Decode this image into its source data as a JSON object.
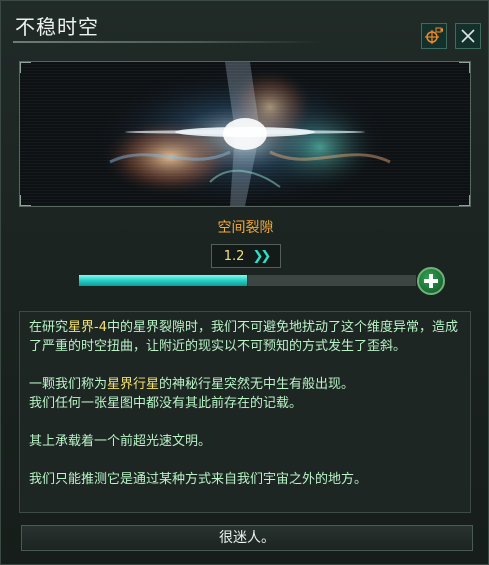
{
  "window": {
    "title": "不稳时空"
  },
  "toolbar": {
    "follow_icon": "target-camera-icon",
    "close_icon": "close-icon"
  },
  "event": {
    "name": "空间裂隙"
  },
  "level": {
    "value": "1.2",
    "arrows_icon": "double-chevron-right-icon"
  },
  "progress": {
    "fraction": 0.5,
    "add_icon": "plus-icon"
  },
  "description": {
    "para1": {
      "t1": "在研究",
      "h1": "星界-4",
      "t2": "中的星界裂隙时，我们不可避免地扰动了这个维度异常，造成了严重的时空扭曲，让附近的现实以不可预知的方式发生了歪斜。"
    },
    "para2": {
      "t1": "一颗我们称为",
      "h1": "星界行星",
      "t2": "的神秘行星突然无中生有般出现。"
    },
    "para3": "我们任何一张星图中都没有其此前存在的记载。",
    "para4": "其上承载着一个前超光速文明。",
    "para5": "我们只能推测它是通过某种方式来自我们宇宙之外的地方。"
  },
  "footer": {
    "confirm_label": "很迷人。"
  },
  "colors": {
    "accent_cyan": "#2fe1c8",
    "highlight_yellow": "#f3e36d",
    "event_orange": "#f2a93b",
    "desc_green": "#b9f3c6"
  }
}
